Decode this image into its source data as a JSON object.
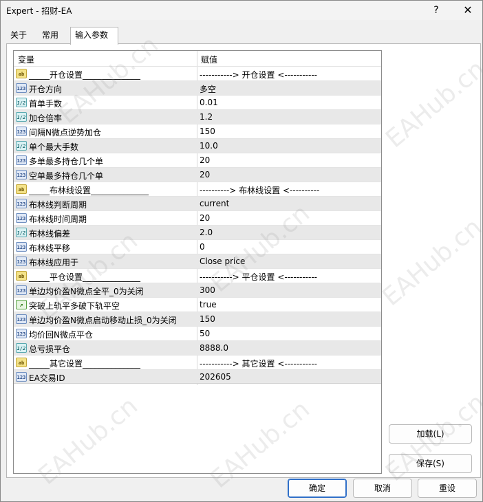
{
  "window": {
    "title": "Expert - 招财-EA",
    "help": "?",
    "close": "✕"
  },
  "tabs": [
    "关于",
    "常用",
    "输入参数"
  ],
  "grid": {
    "header": {
      "variable": "变量",
      "value": "赋值"
    },
    "rows": [
      {
        "icon": "ab",
        "name": "_____开仓设置______________",
        "value": "-----------> 开仓设置 <-----------"
      },
      {
        "icon": "123",
        "name": "开仓方向",
        "value": "多空"
      },
      {
        "icon": "ve",
        "name": "首单手数",
        "value": "0.01"
      },
      {
        "icon": "ve",
        "name": "加仓倍率",
        "value": "1.2"
      },
      {
        "icon": "123",
        "name": "间隔N微点逆势加仓",
        "value": "150"
      },
      {
        "icon": "ve",
        "name": "单个最大手数",
        "value": "10.0"
      },
      {
        "icon": "123",
        "name": "多单最多持仓几个单",
        "value": "20"
      },
      {
        "icon": "123",
        "name": "空单最多持仓几个单",
        "value": "20"
      },
      {
        "icon": "ab",
        "name": "_____布林线设置______________",
        "value": "----------> 布林线设置 <----------"
      },
      {
        "icon": "123",
        "name": "布林线判断周期",
        "value": "current"
      },
      {
        "icon": "123",
        "name": "布林线时间周期",
        "value": "20"
      },
      {
        "icon": "ve",
        "name": "布林线偏差",
        "value": "2.0"
      },
      {
        "icon": "123",
        "name": "布林线平移",
        "value": "0"
      },
      {
        "icon": "123",
        "name": "布林线应用于",
        "value": "Close price"
      },
      {
        "icon": "ab",
        "name": "_____平仓设置______________",
        "value": "-----------> 平仓设置 <-----------"
      },
      {
        "icon": "123",
        "name": "单边均价盈N微点全平_0为关闭",
        "value": "300"
      },
      {
        "icon": "bool",
        "name": "突破上轨平多破下轨平空",
        "value": "true"
      },
      {
        "icon": "123",
        "name": "单边均价盈N微点启动移动止损_0为关闭",
        "value": "150"
      },
      {
        "icon": "123",
        "name": "均价回N微点平仓",
        "value": "50"
      },
      {
        "icon": "ve",
        "name": "总亏损平仓",
        "value": "8888.0"
      },
      {
        "icon": "ab",
        "name": "_____其它设置______________",
        "value": "-----------> 其它设置 <-----------"
      },
      {
        "icon": "123",
        "name": "EA交易ID",
        "value": "202605"
      }
    ]
  },
  "watermark": "EAHub.cn",
  "buttons": {
    "load": "加载(L)",
    "save": "保存(S)",
    "ok": "确定",
    "cancel": "取消",
    "reset": "重设"
  }
}
